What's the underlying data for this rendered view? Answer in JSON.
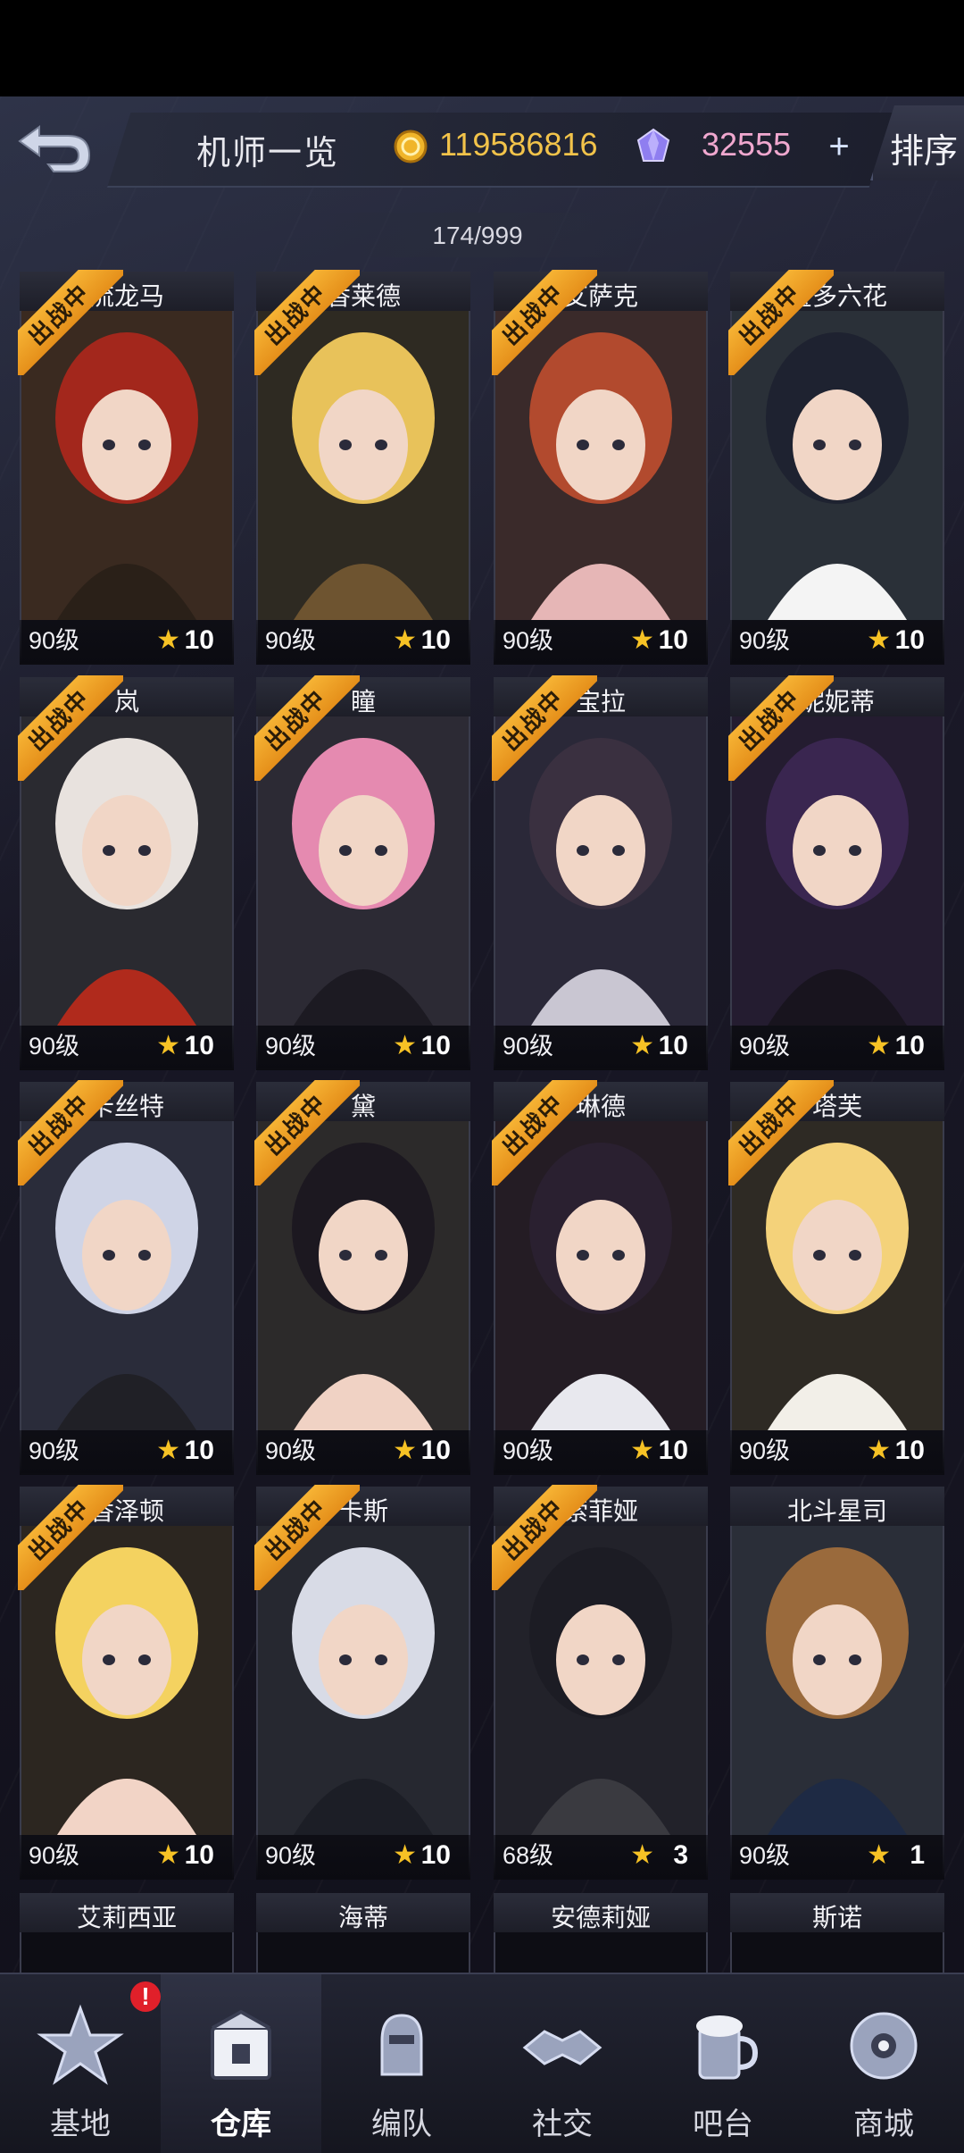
{
  "header": {
    "title": "机师一览",
    "gold": "119586816",
    "gems": "32555",
    "plus": "+",
    "sort_label": "排序"
  },
  "roster_count": "174/999",
  "deploy_label": "出战中",
  "star_glyph": "★",
  "colors": {
    "accent_gold": "#f2c34a",
    "gem_pink": "#f0a8cf",
    "ribbon": "#f6b334",
    "star": "#f6c225"
  },
  "pilots": [
    {
      "name": "流龙马",
      "level": "90级",
      "stars": "10",
      "deployed": true
    },
    {
      "name": "香莱德",
      "level": "90级",
      "stars": "10",
      "deployed": true
    },
    {
      "name": "艾萨克",
      "level": "90级",
      "stars": "10",
      "deployed": true
    },
    {
      "name": "宝多六花",
      "level": "90级",
      "stars": "10",
      "deployed": true
    },
    {
      "name": "岚",
      "level": "90级",
      "stars": "10",
      "deployed": true
    },
    {
      "name": "瞳",
      "level": "90级",
      "stars": "10",
      "deployed": true
    },
    {
      "name": "宝拉",
      "level": "90级",
      "stars": "10",
      "deployed": true
    },
    {
      "name": "妮妮蒂",
      "level": "90级",
      "stars": "10",
      "deployed": true
    },
    {
      "name": "卡丝特",
      "level": "90级",
      "stars": "10",
      "deployed": true
    },
    {
      "name": "黛",
      "level": "90级",
      "stars": "10",
      "deployed": true
    },
    {
      "name": "琳德",
      "level": "90级",
      "stars": "10",
      "deployed": true
    },
    {
      "name": "塔芙",
      "level": "90级",
      "stars": "10",
      "deployed": true
    },
    {
      "name": "香泽顿",
      "level": "90级",
      "stars": "10",
      "deployed": true
    },
    {
      "name": "卡斯",
      "level": "90级",
      "stars": "10",
      "deployed": true
    },
    {
      "name": "索菲娅",
      "level": "68级",
      "stars": "3",
      "deployed": true
    },
    {
      "name": "北斗星司",
      "level": "90级",
      "stars": "1",
      "deployed": false
    },
    {
      "name": "艾莉西亚"
    },
    {
      "name": "海蒂"
    },
    {
      "name": "安德莉娅"
    },
    {
      "name": "斯诺"
    }
  ],
  "nav": [
    {
      "label": "基地",
      "icon": "base-star-icon",
      "badge": "!"
    },
    {
      "label": "仓库",
      "icon": "warehouse-crate-icon",
      "active": true
    },
    {
      "label": "编队",
      "icon": "team-mecha-icon"
    },
    {
      "label": "社交",
      "icon": "handshake-icon"
    },
    {
      "label": "吧台",
      "icon": "beer-mug-icon"
    },
    {
      "label": "商城",
      "icon": "shop-robot-icon"
    }
  ]
}
